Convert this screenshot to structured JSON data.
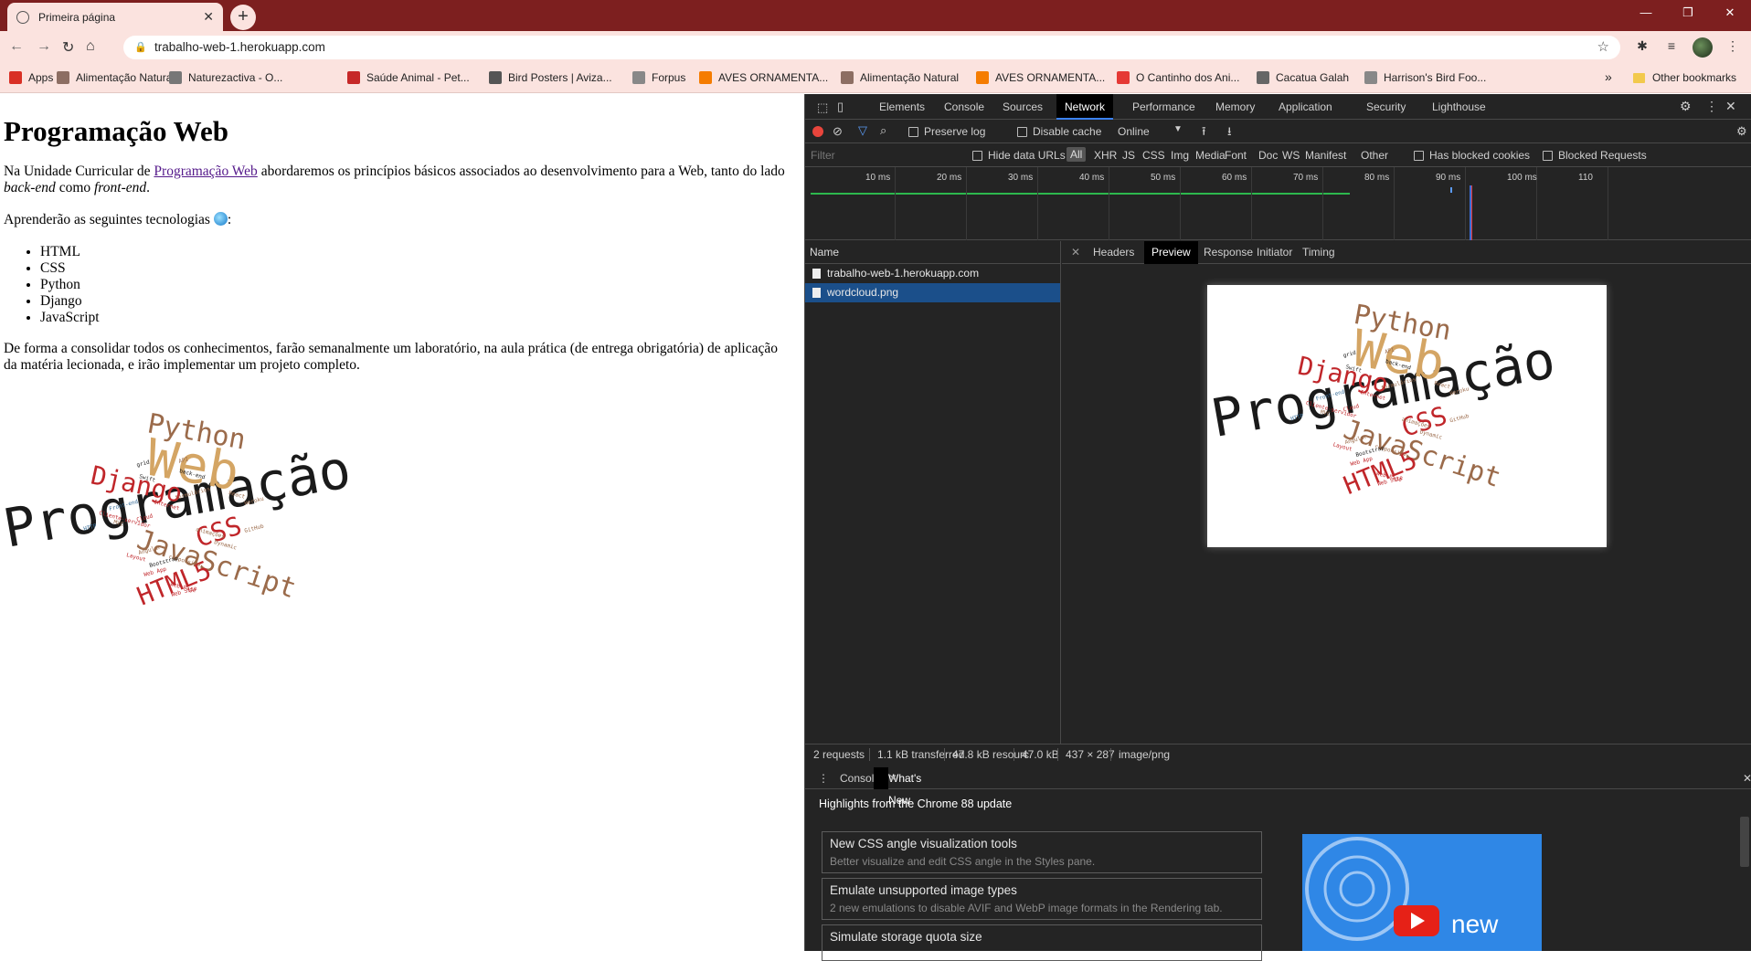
{
  "browser": {
    "tab_title": "Primeira página",
    "url": "trabalho-web-1.herokuapp.com",
    "bookmarks": [
      {
        "label": "Apps",
        "color": "#d93025"
      },
      {
        "label": "Alimentação Natural",
        "color": "#8d6e63"
      },
      {
        "label": "Naturezactiva - O...",
        "color": "#777777"
      },
      {
        "label": "Saúde Animal - Pet...",
        "color": "#c62828"
      },
      {
        "label": "Bird Posters | Aviza...",
        "color": "#555555"
      },
      {
        "label": "Forpus",
        "color": "#888888"
      },
      {
        "label": "AVES ORNAMENTA...",
        "color": "#f57c00"
      },
      {
        "label": "Alimentação Natural",
        "color": "#8d6e63"
      },
      {
        "label": "AVES ORNAMENTA...",
        "color": "#f57c00"
      },
      {
        "label": "O Cantinho dos Ani...",
        "color": "#e53935"
      },
      {
        "label": "Cacatua Galah",
        "color": "#666666"
      },
      {
        "label": "Harrison's Bird Foo...",
        "color": "#888888"
      }
    ],
    "bookmarks_more": "»",
    "other_bookmarks": "Other bookmarks"
  },
  "page": {
    "heading": "Programação Web",
    "intro_prefix": "Na Unidade Curricular de ",
    "intro_link": "Programação Web",
    "intro_mid": " abordaremos os princípios básicos associados ao desenvolvimento para a Web, tanto do lado ",
    "intro_backend": "back-end",
    "intro_como": " como ",
    "intro_frontend": "front-end",
    "intro_end": ".",
    "tech_intro": "Aprenderão as seguintes tecnologias ",
    "tech_colon": ":",
    "technologies": [
      "HTML",
      "CSS",
      "Python",
      "Django",
      "JavaScript"
    ],
    "conclusion": "De forma a consolidar todos os conhecimentos, farão semanalmente um laboratório, na aula prática (de entrega obrigatória) de aplicação da matéria lecionada, e irão implementar um projeto completo."
  },
  "wordcloud": {
    "words_big": [
      "Programação",
      "Web",
      "Python",
      "JavaScript",
      "Django",
      "CSS",
      "HTML5"
    ],
    "words_small": [
      "grid",
      "Swift",
      "API",
      "back-end",
      "formulários",
      "React",
      "Heroku",
      "Internet",
      "Front-end",
      "Cliente-servidor",
      "HTTP",
      "MVC",
      "Cloud",
      "animações",
      "GitHub",
      "Layout",
      "Angular",
      "responsive",
      "Bootstrap",
      "Dynamic",
      "Web App",
      "Web Page",
      "Web Site"
    ],
    "colors": {
      "orange": "#d4a564",
      "dark": "#1a1a1a",
      "red": "#c0262a",
      "brown": "#9b6b4b"
    }
  },
  "devtools": {
    "tabs": [
      "Elements",
      "Console",
      "Sources",
      "Network",
      "Performance",
      "Memory",
      "Application",
      "Security",
      "Lighthouse"
    ],
    "active_tab": "Network",
    "preserve_log": "Preserve log",
    "disable_cache": "Disable cache",
    "throttle": "Online",
    "filter_placeholder": "Filter",
    "hide_data_urls": "Hide data URLs",
    "all": "All",
    "types": [
      "XHR",
      "JS",
      "CSS",
      "Img",
      "Media",
      "Font",
      "Doc",
      "WS",
      "Manifest",
      "Other"
    ],
    "has_blocked_cookies": "Has blocked cookies",
    "blocked_requests": "Blocked Requests",
    "timeline_ticks": [
      "10 ms",
      "20 ms",
      "30 ms",
      "40 ms",
      "50 ms",
      "60 ms",
      "70 ms",
      "80 ms",
      "90 ms",
      "100 ms",
      "110"
    ],
    "name_header": "Name",
    "requests": [
      {
        "name": "trabalho-web-1.herokuapp.com",
        "selected": false
      },
      {
        "name": "wordcloud.png",
        "selected": true
      }
    ],
    "detail_tabs": [
      "Headers",
      "Preview",
      "Response",
      "Initiator",
      "Timing"
    ],
    "detail_active": "Preview",
    "status": {
      "requests": "2 requests",
      "transferred": "1.1 kB transferred",
      "resources": "47.8 kB resourc",
      "size": "47.0 kB",
      "dims": "437 × 287",
      "mime": "image/png"
    },
    "drawer_tabs": [
      "Console",
      "What's New"
    ],
    "drawer_active": "What's New",
    "highlights": "Highlights from the Chrome 88 update",
    "whats_new": [
      {
        "title": "New CSS angle visualization tools",
        "desc": "Better visualize and edit CSS angle in the Styles pane."
      },
      {
        "title": "Emulate unsupported image types",
        "desc": "2 new emulations to disable AVIF and WebP image formats in the Rendering tab."
      },
      {
        "title": "Simulate storage quota size",
        "desc": ""
      }
    ],
    "video_label": "new"
  }
}
